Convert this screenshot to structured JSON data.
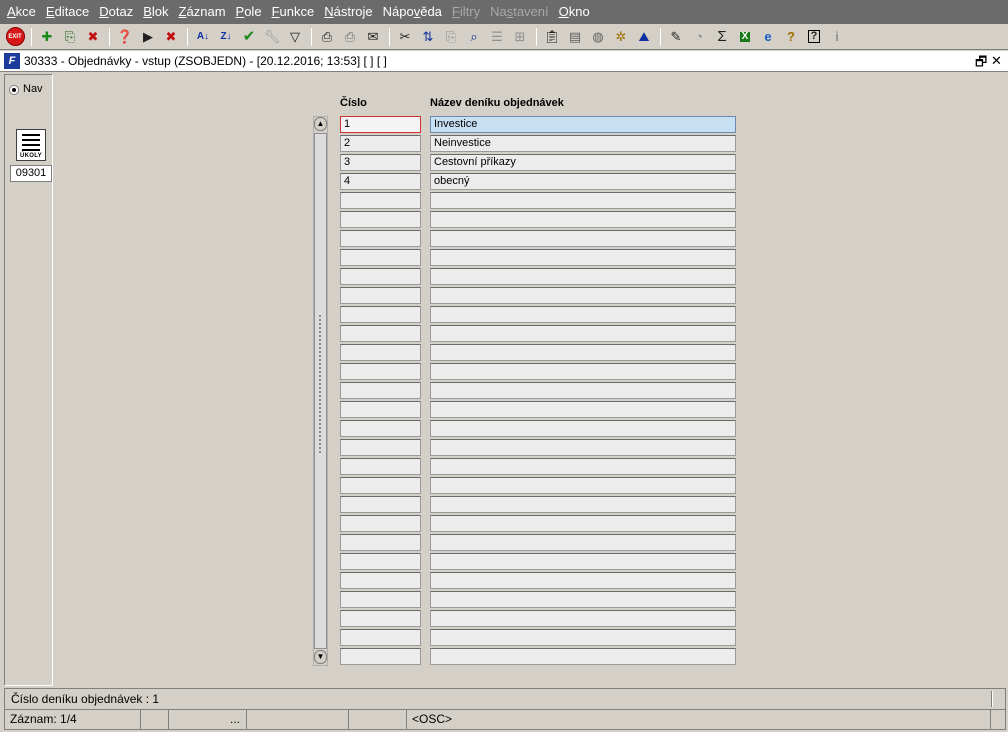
{
  "menu": [
    {
      "label": "Akce",
      "accel": "A",
      "enabled": true
    },
    {
      "label": "Editace",
      "accel": "E",
      "enabled": true
    },
    {
      "label": "Dotaz",
      "accel": "D",
      "enabled": true
    },
    {
      "label": "Blok",
      "accel": "B",
      "enabled": true
    },
    {
      "label": "Záznam",
      "accel": "Z",
      "enabled": true
    },
    {
      "label": "Pole",
      "accel": "P",
      "enabled": true
    },
    {
      "label": "Funkce",
      "accel": "F",
      "enabled": true
    },
    {
      "label": "Nástroje",
      "accel": "N",
      "enabled": true
    },
    {
      "label": "Nápověda",
      "accel": "v",
      "enabled": true
    },
    {
      "label": "Filtry",
      "accel": "F",
      "enabled": false
    },
    {
      "label": "Nastavení",
      "accel": "s",
      "enabled": false
    },
    {
      "label": "Okno",
      "accel": "O",
      "enabled": true
    }
  ],
  "toolbar": {
    "exit_label": "EXIT"
  },
  "window": {
    "title": "30333 - Objednávky - vstup (ZSOBJEDN) - [20.12.2016; 13:53]  [ ] [ ]",
    "logo_text": "F"
  },
  "nav": {
    "radio_label": "Nav",
    "ukoly_label": "ÚKOLY",
    "code": "09301"
  },
  "table": {
    "headers": {
      "number": "Číslo",
      "name": "Název deníku objednávek"
    },
    "rows": [
      {
        "number": "1",
        "name": "Investice"
      },
      {
        "number": "2",
        "name": "Neinvestice"
      },
      {
        "number": "3",
        "name": "Cestovní příkazy"
      },
      {
        "number": "4",
        "name": "obecný"
      },
      {
        "number": "",
        "name": ""
      },
      {
        "number": "",
        "name": ""
      },
      {
        "number": "",
        "name": ""
      },
      {
        "number": "",
        "name": ""
      },
      {
        "number": "",
        "name": ""
      },
      {
        "number": "",
        "name": ""
      },
      {
        "number": "",
        "name": ""
      },
      {
        "number": "",
        "name": ""
      },
      {
        "number": "",
        "name": ""
      },
      {
        "number": "",
        "name": ""
      },
      {
        "number": "",
        "name": ""
      },
      {
        "number": "",
        "name": ""
      },
      {
        "number": "",
        "name": ""
      },
      {
        "number": "",
        "name": ""
      },
      {
        "number": "",
        "name": ""
      },
      {
        "number": "",
        "name": ""
      },
      {
        "number": "",
        "name": ""
      },
      {
        "number": "",
        "name": ""
      },
      {
        "number": "",
        "name": ""
      },
      {
        "number": "",
        "name": ""
      },
      {
        "number": "",
        "name": ""
      },
      {
        "number": "",
        "name": ""
      },
      {
        "number": "",
        "name": ""
      },
      {
        "number": "",
        "name": ""
      },
      {
        "number": "",
        "name": ""
      }
    ],
    "active_row": 0
  },
  "status": {
    "message": "Číslo deníku objednávek : 1",
    "record": "Záznam: 1/4",
    "dots": "...",
    "osc": "<OSC>"
  },
  "colors": {
    "menubar": "#6b6b6b",
    "active_cell_border": "#d03030",
    "active_name_bg": "#c8e0f4"
  }
}
